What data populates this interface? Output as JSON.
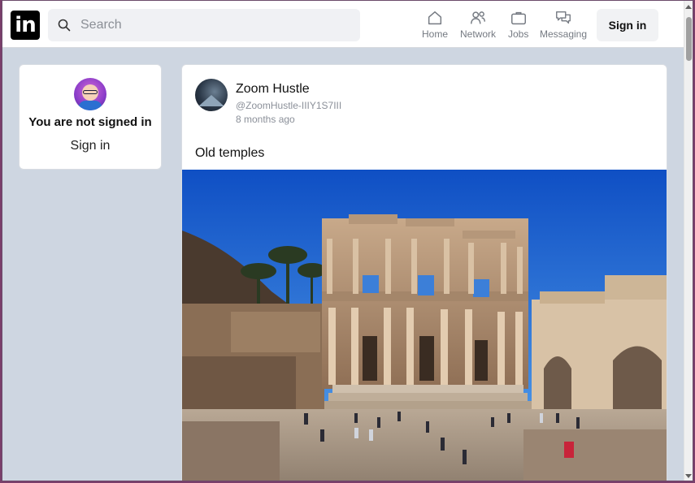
{
  "header": {
    "logo_text": "in",
    "search_placeholder": "Search",
    "nav": [
      {
        "label": "Home",
        "icon": "home-icon"
      },
      {
        "label": "Network",
        "icon": "network-icon"
      },
      {
        "label": "Jobs",
        "icon": "briefcase-icon"
      },
      {
        "label": "Messaging",
        "icon": "messaging-icon"
      }
    ],
    "signin_label": "Sign in"
  },
  "sidebar": {
    "status_text": "You are not signed in",
    "signin_label": "Sign in"
  },
  "post": {
    "author_name": "Zoom Hustle",
    "author_handle": "@ZoomHustle-IIIY1S7III",
    "time_ago": "8 months ago",
    "text": "Old temples",
    "image_alt": "Ancient library ruins with tourists"
  },
  "colors": {
    "page_background": "#ced6e1",
    "card_background": "#ffffff",
    "logo_background": "#000000",
    "sky": "#1f6fd6"
  }
}
